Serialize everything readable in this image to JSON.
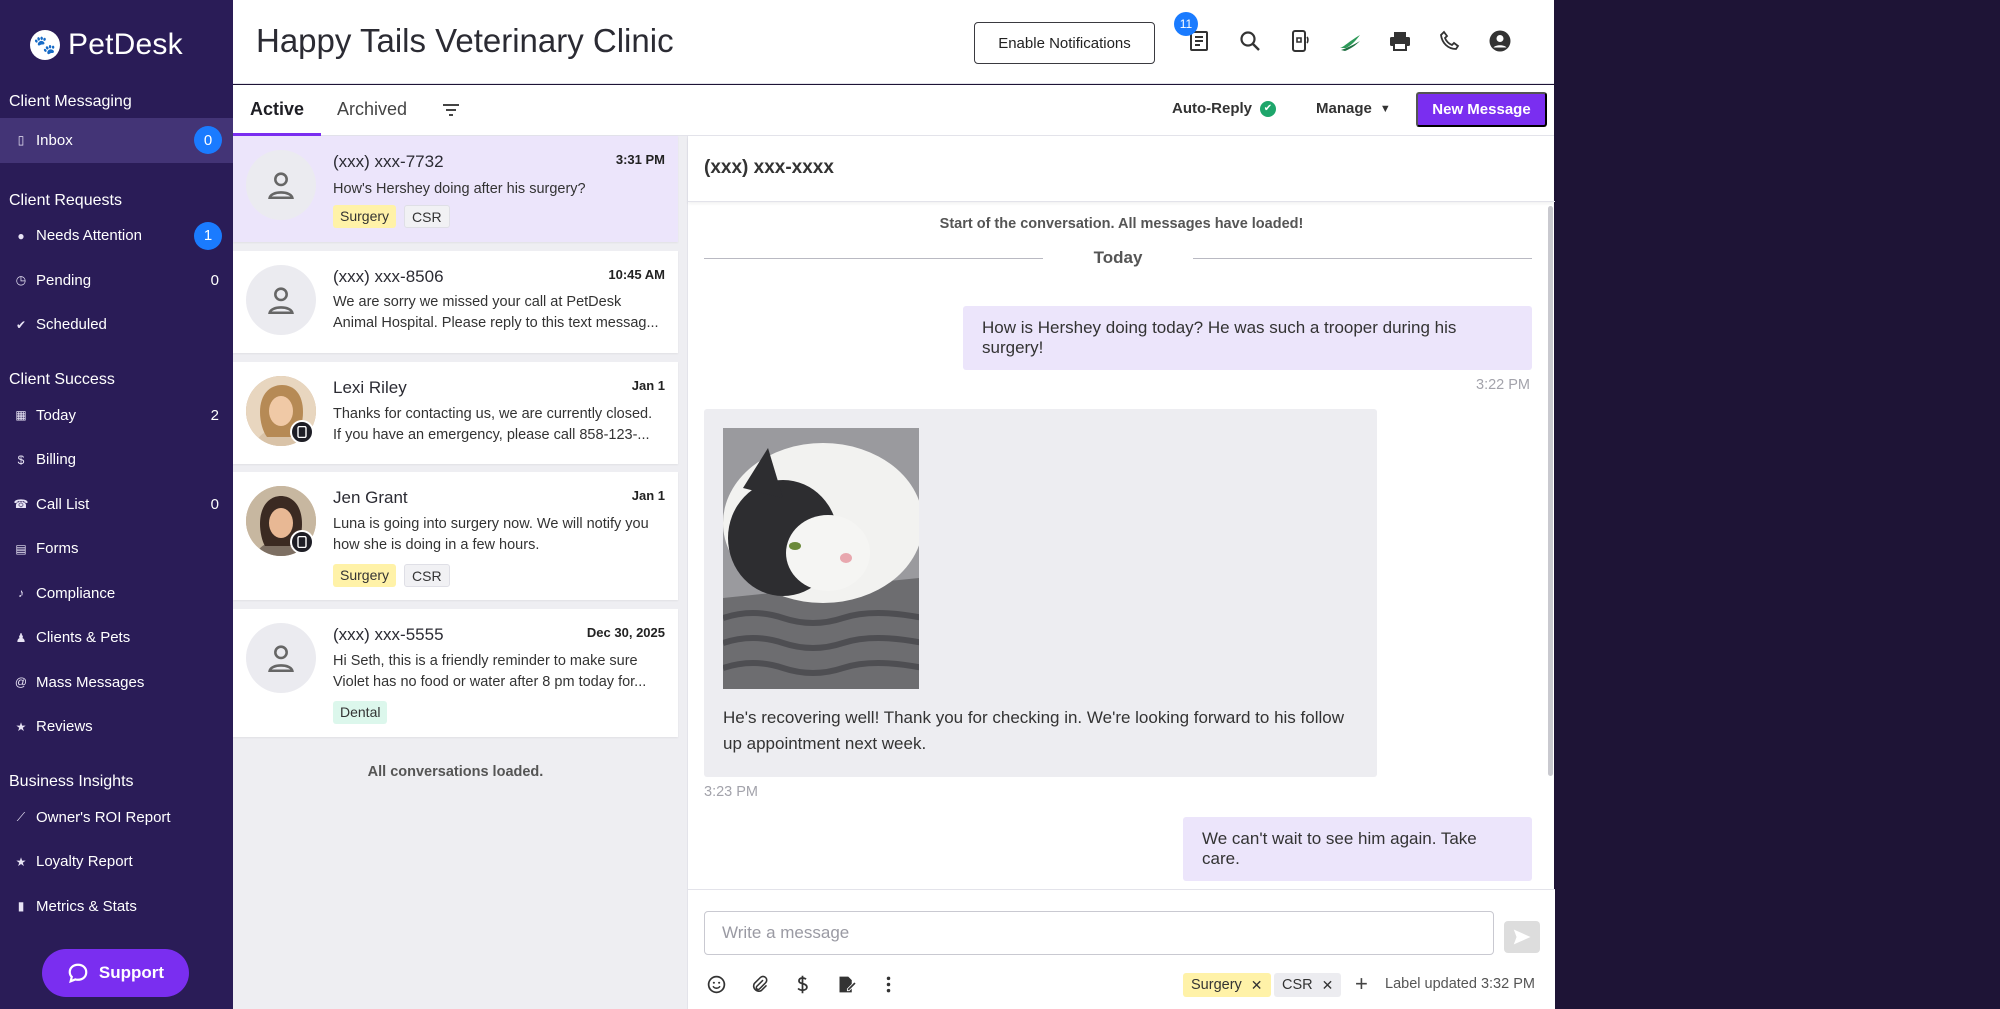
{
  "app": {
    "brand": "PetDesk"
  },
  "sidebar": {
    "sections": [
      {
        "title": "Client Messaging",
        "items": [
          {
            "label": "Inbox",
            "icon": "phone-icon",
            "badge": "0"
          }
        ]
      },
      {
        "title": "Client Requests",
        "items": [
          {
            "label": "Needs Attention",
            "icon": "alert-icon",
            "badge": "1"
          },
          {
            "label": "Pending",
            "icon": "clock-icon",
            "count": "0"
          },
          {
            "label": "Scheduled",
            "icon": "check-icon"
          }
        ]
      },
      {
        "title": "Client Success",
        "items": [
          {
            "label": "Today",
            "icon": "calendar-icon",
            "count": "2"
          },
          {
            "label": "Billing",
            "icon": "dollar-icon"
          },
          {
            "label": "Call List",
            "icon": "phone-box-icon",
            "count": "0"
          },
          {
            "label": "Forms",
            "icon": "document-icon"
          },
          {
            "label": "Compliance",
            "icon": "bell-icon"
          },
          {
            "label": "Clients & Pets",
            "icon": "person-icon"
          },
          {
            "label": "Mass Messages",
            "icon": "at-icon"
          },
          {
            "label": "Reviews",
            "icon": "star-icon"
          }
        ]
      },
      {
        "title": "Business Insights",
        "items": [
          {
            "label": "Owner's ROI Report",
            "icon": "line-chart-icon"
          },
          {
            "label": "Loyalty Report",
            "icon": "star-icon"
          },
          {
            "label": "Metrics & Stats",
            "icon": "bar-chart-icon"
          }
        ]
      }
    ],
    "support_label": "Support"
  },
  "header": {
    "clinic_name": "Happy Tails Veterinary Clinic",
    "enable_notifications": "Enable Notifications",
    "notification_count": "11",
    "icons": [
      "notes-icon",
      "search-icon",
      "phone-sms-icon",
      "leaf-logo-icon",
      "printer-icon",
      "phone-call-icon",
      "account-icon"
    ]
  },
  "toolbar": {
    "tabs": [
      "Active",
      "Archived"
    ],
    "auto_reply": "Auto-Reply",
    "manage": "Manage",
    "new_message": "New Message"
  },
  "conversations": [
    {
      "name": "(xxx) xxx-7732",
      "time": "3:31 PM",
      "preview": "How's Hershey doing after his surgery?",
      "tags": [
        "Surgery",
        "CSR"
      ],
      "selected": true
    },
    {
      "name": "(xxx) xxx-8506",
      "time": "10:45 AM",
      "preview": "We are sorry we missed your call at PetDesk Animal Hospital. Please reply to this text messag...",
      "tags": []
    },
    {
      "name": "Lexi Riley",
      "time": "Jan 1",
      "preview": "Thanks for contacting us, we are currently closed. If you have an emergency, please call 858-123-...",
      "tags": []
    },
    {
      "name": "Jen Grant",
      "time": "Jan 1",
      "preview": "Luna is going into surgery now. We will notify you how she is doing in a few hours.",
      "tags": [
        "Surgery",
        "CSR"
      ]
    },
    {
      "name": "(xxx) xxx-5555",
      "time": "Dec 30, 2025",
      "preview": "Hi Seth, this is a friendly reminder to make sure Violet has no food or water after 8 pm today for...",
      "tags": [
        "Dental"
      ]
    }
  ],
  "conversations_footer": "All conversations loaded.",
  "chat": {
    "title": "(xxx) xxx-xxxx",
    "start_text": "Start of the conversation. All messages have loaded!",
    "divider": "Today",
    "messages": [
      {
        "direction": "out",
        "text": "How is Hershey doing today? He was such a trooper during his surgery!",
        "time": "3:22 PM"
      },
      {
        "direction": "in",
        "text": "He's recovering well! Thank you for checking in. We're looking forward to his follow up appointment next week.",
        "time": "3:23 PM",
        "has_image": true
      },
      {
        "direction": "out",
        "text": "We can't wait to see him again. Take care."
      }
    ]
  },
  "composer": {
    "placeholder": "Write a message",
    "labels": [
      "Surgery",
      "CSR"
    ],
    "label_updated": "Label updated 3:32 PM"
  },
  "colors": {
    "sidebar": "#2a1c57",
    "accent": "#7a2ef0",
    "badge": "#1a7bff",
    "bubble_out": "#ece5fb",
    "bubble_in": "#ededf1"
  }
}
